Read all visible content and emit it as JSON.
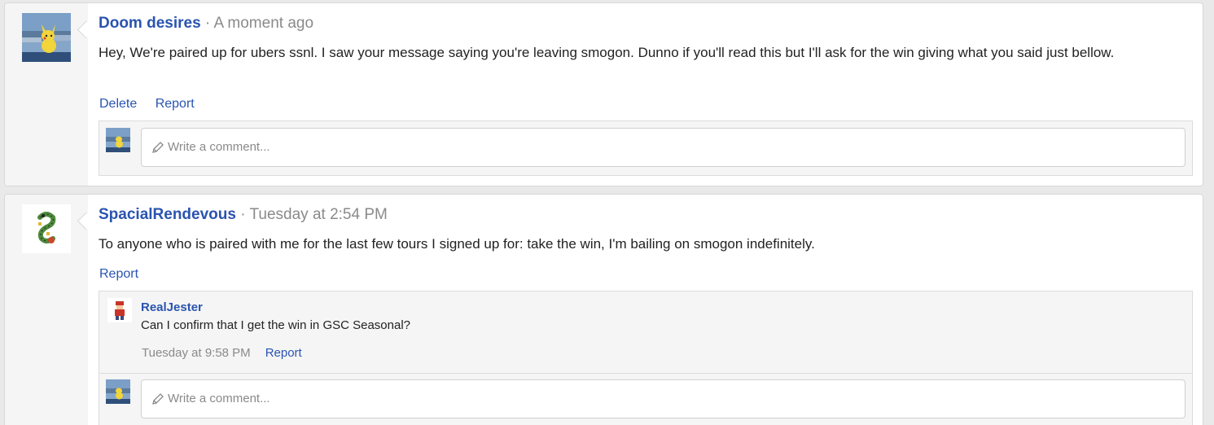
{
  "messages": [
    {
      "username": "Doom desires",
      "separator": " · ",
      "time": "A moment ago",
      "body": "Hey, We're paired up for ubers ssnl. I saw your message saying you're leaving smogon. Dunno if you'll read this but I'll ask for the win giving what you said just bellow.",
      "actions": [
        "Delete",
        "Report"
      ],
      "comment_placeholder": "Write a comment..."
    },
    {
      "username": "SpacialRendevous",
      "separator": " · ",
      "time": "Tuesday at 2:54 PM",
      "body": "To anyone who is paired with me for the last few tours I signed up for: take the win, I'm bailing on smogon indefinitely.",
      "actions": [
        "Report"
      ],
      "comments": [
        {
          "username": "RealJester",
          "text": "Can I confirm that I get the win in GSC Seasonal?",
          "time": "Tuesday at 9:58 PM",
          "report_label": "Report"
        }
      ],
      "comment_placeholder": "Write a comment..."
    }
  ],
  "icons": {
    "pencil": "pencil-icon"
  },
  "colors": {
    "link": "#2a54b0",
    "muted": "#8a8a8a",
    "text": "#222222",
    "panel": "#f5f5f5"
  }
}
